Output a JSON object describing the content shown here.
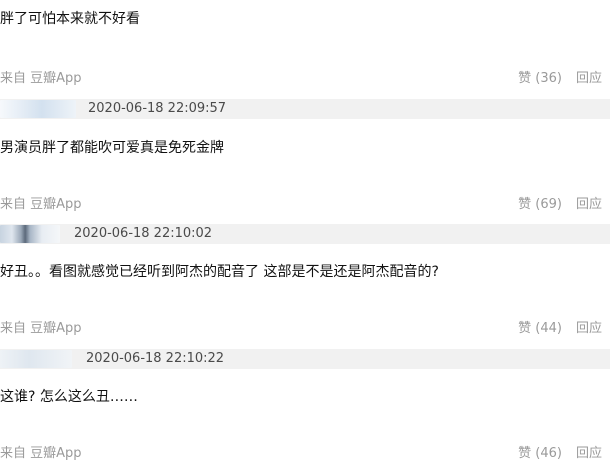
{
  "comments": [
    {
      "text": "胖了可怕本来就不好看",
      "source": "来自 豆瓣App",
      "likes": "赞 (36)",
      "reply": "回应"
    },
    {
      "timestamp": "2020-06-18 22:09:57",
      "text": "男演员胖了都能吹可爱真是免死金牌",
      "source": "来自 豆瓣App",
      "likes": "赞 (69)",
      "reply": "回应"
    },
    {
      "timestamp": "2020-06-18 22:10:02",
      "text": "好丑。。看图就感觉已经听到阿杰的配音了 这部是不是还是阿杰配音的?",
      "source": "来自 豆瓣App",
      "likes": "赞 (44)",
      "reply": "回应"
    },
    {
      "timestamp": "2020-06-18 22:10:22",
      "text": "这谁? 怎么这么丑……",
      "source": "来自 豆瓣App",
      "likes": "赞 (46)",
      "reply": "回应"
    }
  ]
}
